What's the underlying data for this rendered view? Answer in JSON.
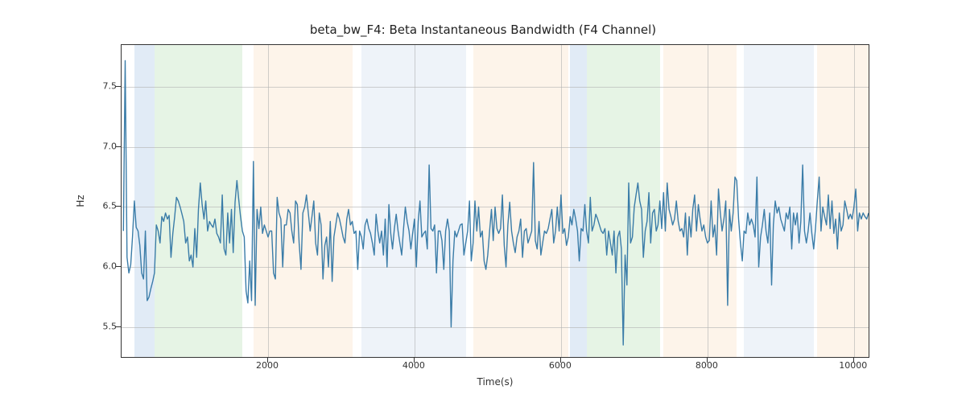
{
  "chart_data": {
    "type": "line",
    "title": "beta_bw_F4: Beta Instantaneous Bandwidth (F4 Channel)",
    "xlabel": "Time(s)",
    "ylabel": "Hz",
    "xlim": [
      0,
      10200
    ],
    "ylim": [
      5.25,
      7.85
    ],
    "yticks": [
      5.5,
      6.0,
      6.5,
      7.0,
      7.5
    ],
    "xticks": [
      2000,
      4000,
      6000,
      8000,
      10000
    ],
    "bands": [
      {
        "x0": 180,
        "x1": 450,
        "color": "blue"
      },
      {
        "x0": 450,
        "x1": 1650,
        "color": "green"
      },
      {
        "x0": 1800,
        "x1": 3150,
        "color": "orange2"
      },
      {
        "x0": 3280,
        "x1": 4700,
        "color": "blue2"
      },
      {
        "x0": 4800,
        "x1": 6100,
        "color": "orange2"
      },
      {
        "x0": 6120,
        "x1": 6350,
        "color": "blue"
      },
      {
        "x0": 6350,
        "x1": 7350,
        "color": "green"
      },
      {
        "x0": 7400,
        "x1": 8400,
        "color": "orange2"
      },
      {
        "x0": 8500,
        "x1": 9450,
        "color": "blue2"
      },
      {
        "x0": 9500,
        "x1": 10200,
        "color": "orange2"
      }
    ],
    "series": [
      {
        "name": "beta_bw_F4",
        "x_step": 25,
        "x_start": 25,
        "values": [
          6.3,
          7.72,
          6.08,
          5.95,
          6.02,
          6.25,
          6.55,
          6.33,
          6.3,
          6.18,
          5.95,
          5.9,
          6.3,
          5.72,
          5.75,
          5.82,
          5.88,
          5.95,
          6.35,
          6.3,
          6.2,
          6.42,
          6.38,
          6.45,
          6.4,
          6.43,
          6.08,
          6.28,
          6.42,
          6.58,
          6.55,
          6.5,
          6.44,
          6.38,
          6.2,
          6.25,
          6.05,
          6.1,
          6.0,
          6.32,
          6.08,
          6.48,
          6.7,
          6.52,
          6.4,
          6.55,
          6.3,
          6.38,
          6.35,
          6.33,
          6.4,
          6.28,
          6.25,
          6.2,
          6.6,
          6.15,
          6.1,
          6.45,
          6.2,
          6.48,
          6.12,
          6.54,
          6.72,
          6.56,
          6.42,
          6.3,
          6.25,
          5.8,
          5.7,
          6.05,
          5.72,
          6.88,
          5.68,
          6.48,
          6.32,
          6.5,
          6.28,
          6.35,
          6.3,
          6.25,
          6.3,
          6.3,
          5.95,
          5.9,
          6.58,
          6.45,
          6.4,
          6.0,
          6.35,
          6.35,
          6.48,
          6.45,
          6.3,
          6.2,
          6.55,
          6.52,
          6.2,
          5.98,
          6.45,
          6.5,
          6.6,
          6.45,
          6.3,
          6.42,
          6.55,
          6.2,
          6.1,
          6.45,
          6.35,
          5.9,
          6.18,
          6.25,
          6.0,
          6.38,
          5.88,
          6.25,
          6.35,
          6.45,
          6.4,
          6.33,
          6.25,
          6.2,
          6.4,
          6.48,
          6.35,
          6.38,
          6.28,
          6.3,
          5.98,
          6.3,
          6.25,
          6.15,
          6.35,
          6.4,
          6.32,
          6.28,
          6.2,
          6.1,
          6.44,
          6.3,
          6.2,
          6.3,
          6.1,
          6.4,
          6.0,
          6.52,
          6.28,
          6.15,
          6.32,
          6.44,
          6.3,
          6.2,
          6.1,
          6.32,
          6.5,
          6.38,
          6.3,
          6.15,
          6.28,
          6.4,
          6.0,
          6.38,
          6.55,
          6.25,
          6.28,
          6.3,
          6.15,
          6.85,
          6.32,
          6.3,
          6.35,
          5.95,
          6.3,
          6.3,
          6.22,
          5.98,
          6.3,
          6.4,
          6.3,
          5.5,
          6.05,
          6.3,
          6.25,
          6.3,
          6.35,
          6.36,
          6.1,
          6.2,
          6.3,
          6.55,
          6.05,
          6.2,
          6.55,
          6.3,
          6.5,
          6.25,
          6.3,
          6.05,
          5.98,
          6.1,
          6.3,
          6.48,
          6.22,
          6.5,
          6.32,
          6.28,
          6.32,
          6.6,
          6.18,
          6.0,
          6.35,
          6.54,
          6.3,
          6.2,
          6.12,
          6.25,
          6.3,
          6.4,
          6.08,
          6.3,
          6.32,
          6.2,
          6.25,
          6.3,
          6.87,
          6.22,
          6.15,
          6.38,
          6.1,
          6.2,
          6.3,
          6.28,
          6.32,
          6.4,
          6.48,
          6.2,
          6.3,
          6.5,
          6.3,
          6.6,
          6.28,
          6.32,
          6.18,
          6.25,
          6.42,
          6.35,
          6.48,
          6.4,
          6.3,
          6.05,
          6.32,
          6.3,
          6.52,
          6.3,
          6.2,
          6.58,
          6.3,
          6.35,
          6.44,
          6.4,
          6.35,
          6.3,
          6.28,
          6.32,
          6.1,
          6.3,
          6.2,
          6.1,
          6.3,
          5.95,
          6.25,
          6.3,
          6.15,
          5.35,
          6.1,
          5.85,
          6.7,
          6.2,
          6.25,
          6.5,
          6.6,
          6.7,
          6.55,
          6.48,
          6.08,
          6.3,
          6.38,
          6.62,
          6.2,
          6.45,
          6.48,
          6.3,
          6.35,
          6.55,
          6.32,
          6.62,
          6.3,
          6.7,
          6.48,
          6.42,
          6.35,
          6.4,
          6.55,
          6.38,
          6.3,
          6.32,
          6.25,
          6.45,
          6.1,
          6.42,
          6.25,
          6.48,
          6.6,
          6.3,
          6.52,
          6.4,
          6.3,
          6.35,
          6.25,
          6.2,
          6.22,
          6.55,
          6.25,
          6.35,
          6.1,
          6.65,
          6.45,
          6.3,
          6.4,
          6.55,
          5.68,
          6.48,
          6.3,
          6.45,
          6.75,
          6.72,
          6.4,
          6.2,
          6.05,
          6.3,
          6.28,
          6.45,
          6.35,
          6.4,
          6.35,
          6.25,
          6.75,
          6.0,
          6.25,
          6.35,
          6.48,
          6.3,
          6.2,
          6.45,
          5.85,
          6.35,
          6.55,
          6.45,
          6.5,
          6.4,
          6.35,
          6.3,
          6.45,
          6.4,
          6.5,
          6.15,
          6.45,
          6.35,
          6.45,
          6.2,
          6.38,
          6.85,
          6.3,
          6.2,
          6.3,
          6.45,
          6.28,
          6.15,
          6.32,
          6.55,
          6.75,
          6.3,
          6.5,
          6.42,
          6.35,
          6.6,
          6.32,
          6.55,
          6.28,
          6.4,
          6.15,
          6.45,
          6.3,
          6.35,
          6.55,
          6.48,
          6.4,
          6.44,
          6.4,
          6.5,
          6.65,
          6.3,
          6.45,
          6.4,
          6.45,
          6.42,
          6.4,
          6.45
        ]
      }
    ]
  }
}
